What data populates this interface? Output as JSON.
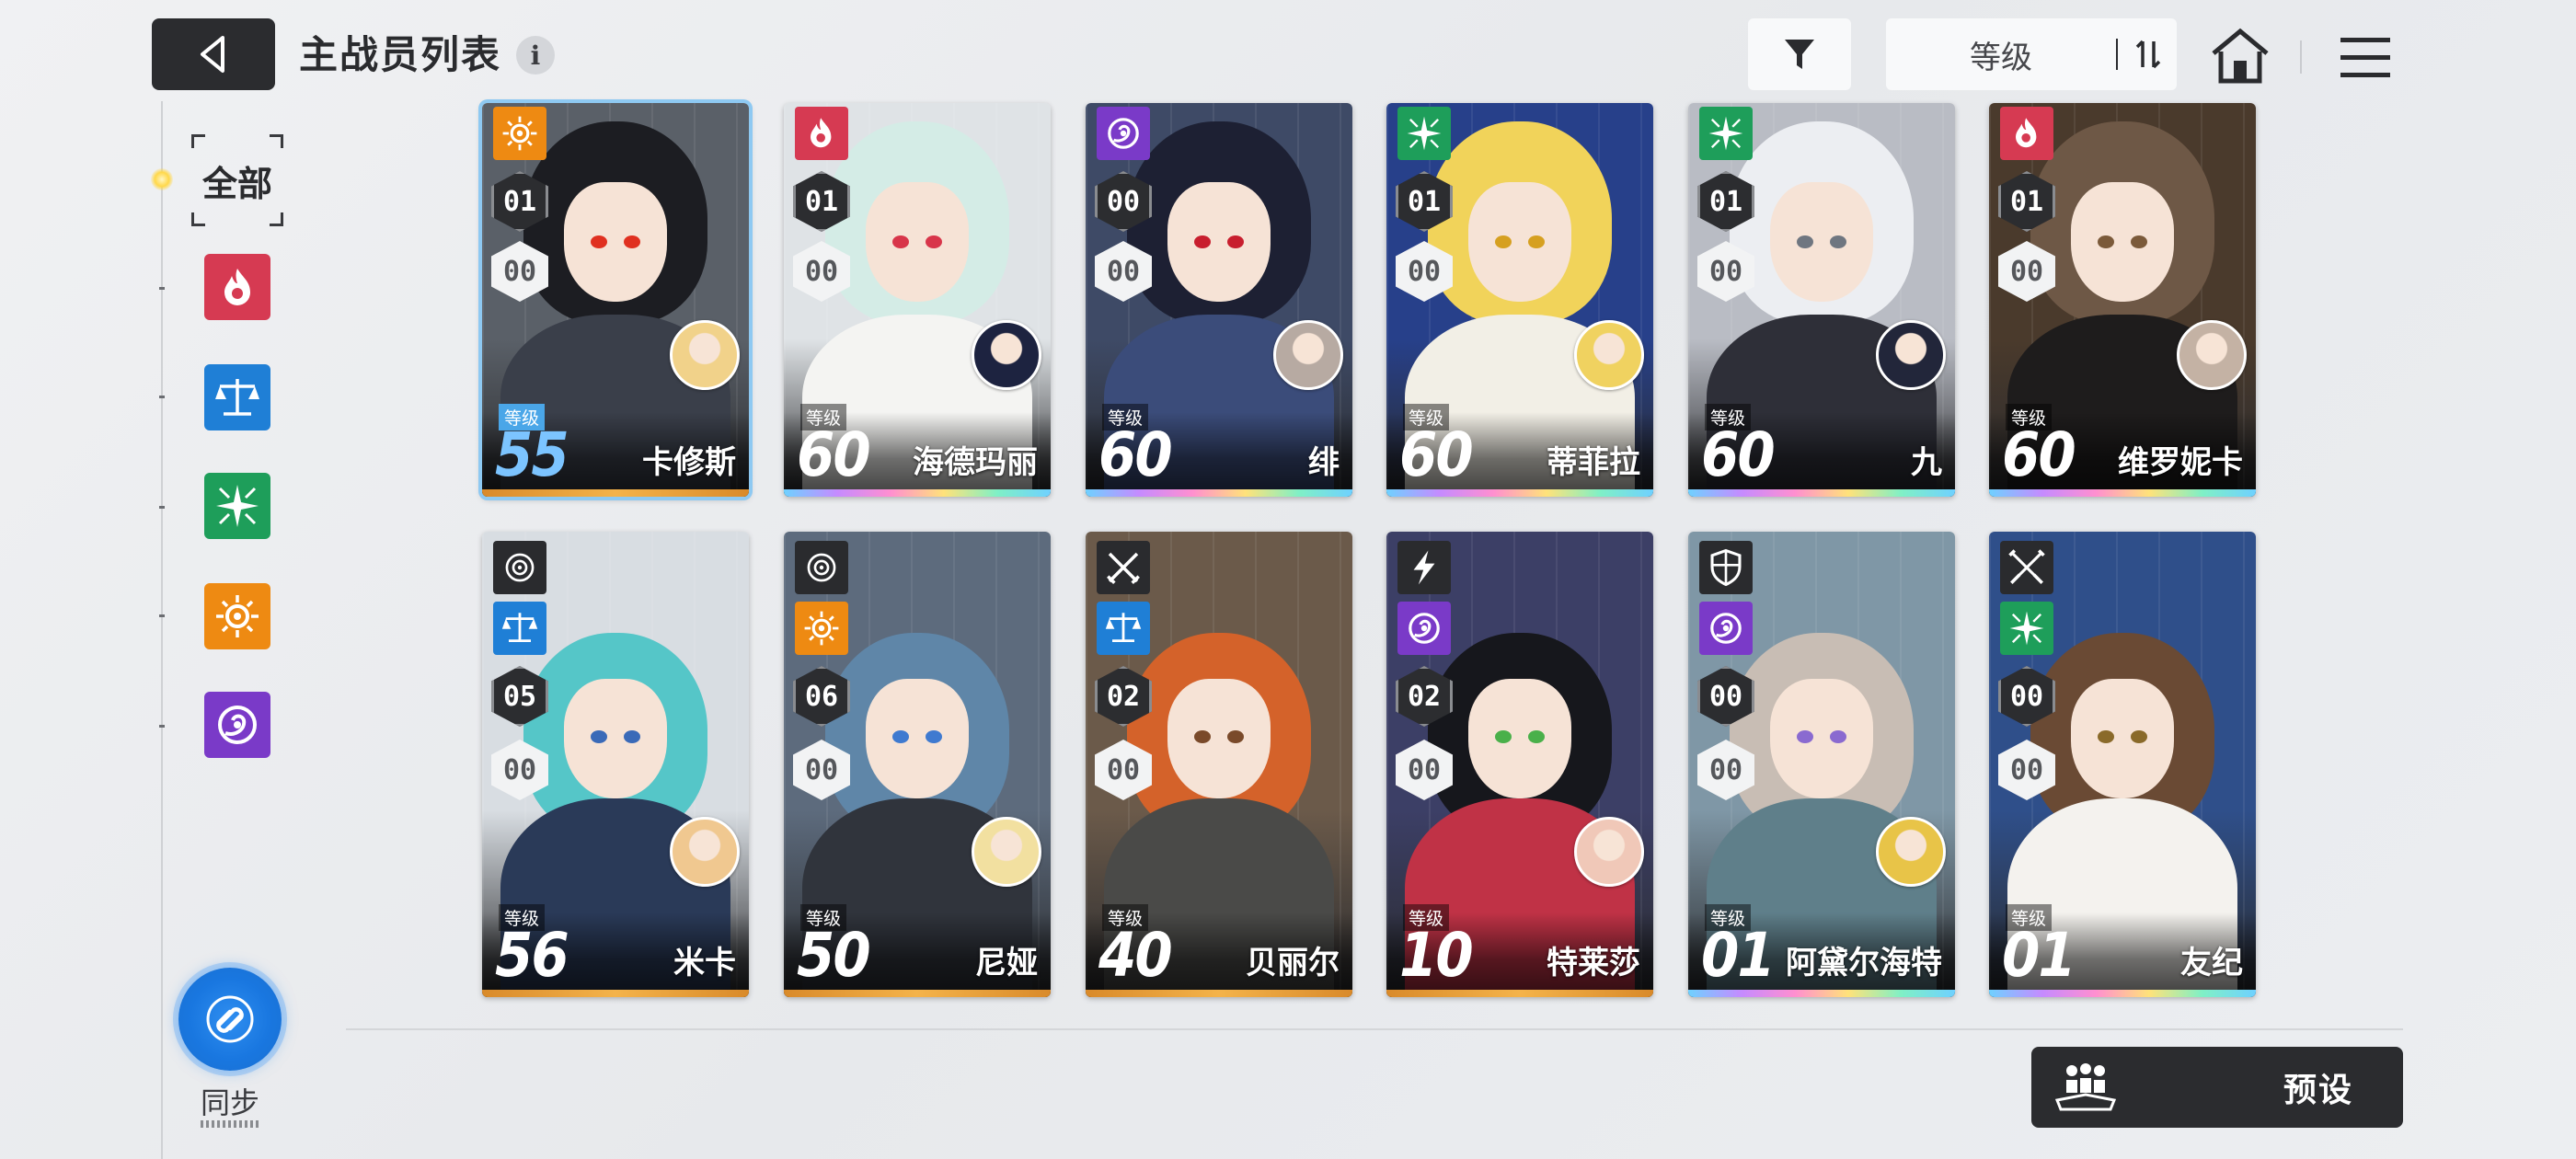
{
  "header": {
    "title": "主战员列表",
    "info_icon": "i",
    "sort_label": "等级",
    "icons": [
      "back-arrow-icon",
      "filter-funnel-icon",
      "sort-toggle-icon",
      "home-icon",
      "hamburger-menu-icon"
    ]
  },
  "sidebar": {
    "all_label": "全部",
    "filters": [
      {
        "name": "burning",
        "icon": "flame-element-icon",
        "color": "#d63a52"
      },
      {
        "name": "balance",
        "icon": "scales-element-icon",
        "color": "#1f7fd6"
      },
      {
        "name": "cross",
        "icon": "star-cross-element-icon",
        "color": "#1e9e5a"
      },
      {
        "name": "sun",
        "icon": "sun-element-icon",
        "color": "#ee8a12"
      },
      {
        "name": "void",
        "icon": "vortex-element-icon",
        "color": "#7a3ac8"
      }
    ],
    "sync_label": "同步"
  },
  "level_word": "等级",
  "cards": [
    {
      "name": "卡修斯",
      "level": "55",
      "rank": "01",
      "sub": "00",
      "element": "sun",
      "class_icon": null,
      "selected": true,
      "edge": "gold"
    },
    {
      "name": "海德玛丽",
      "level": "60",
      "rank": "01",
      "sub": "00",
      "element": "burning",
      "class_icon": null,
      "selected": false,
      "edge": "rainbow"
    },
    {
      "name": "绯",
      "level": "60",
      "rank": "00",
      "sub": "00",
      "element": "void",
      "class_icon": null,
      "selected": false,
      "edge": "rainbow"
    },
    {
      "name": "蒂菲拉",
      "level": "60",
      "rank": "01",
      "sub": "00",
      "element": "cross",
      "class_icon": null,
      "selected": false,
      "edge": "rainbow"
    },
    {
      "name": "九",
      "level": "60",
      "rank": "01",
      "sub": "00",
      "element": "cross",
      "class_icon": null,
      "selected": false,
      "edge": "rainbow"
    },
    {
      "name": "维罗妮卡",
      "level": "60",
      "rank": "01",
      "sub": "00",
      "element": "burning",
      "class_icon": null,
      "selected": false,
      "edge": "rainbow"
    },
    {
      "name": "米卡",
      "level": "56",
      "rank": "05",
      "sub": "00",
      "element": "balance",
      "class_icon": "target-class-icon",
      "selected": false,
      "edge": "gold"
    },
    {
      "name": "尼娅",
      "level": "50",
      "rank": "06",
      "sub": "00",
      "element": "sun",
      "class_icon": "target-class-icon",
      "selected": false,
      "edge": "gold"
    },
    {
      "name": "贝丽尔",
      "level": "40",
      "rank": "02",
      "sub": "00",
      "element": "balance",
      "class_icon": "crossed-swords-class-icon",
      "selected": false,
      "edge": "gold"
    },
    {
      "name": "特莱莎",
      "level": "10",
      "rank": "02",
      "sub": "00",
      "element": "void",
      "class_icon": "lightning-class-icon",
      "selected": false,
      "edge": "gold"
    },
    {
      "name": "阿黛尔海特",
      "level": "01",
      "rank": "00",
      "sub": "00",
      "element": "void",
      "class_icon": "shield-class-icon",
      "selected": false,
      "edge": "rainbow"
    },
    {
      "name": "友纪",
      "level": "01",
      "rank": "00",
      "sub": "00",
      "element": "cross",
      "class_icon": "crossed-blades-class-icon",
      "selected": false,
      "edge": "rainbow"
    }
  ],
  "footer": {
    "preset_label": "预设",
    "preset_icon": "squad-people-icon"
  }
}
